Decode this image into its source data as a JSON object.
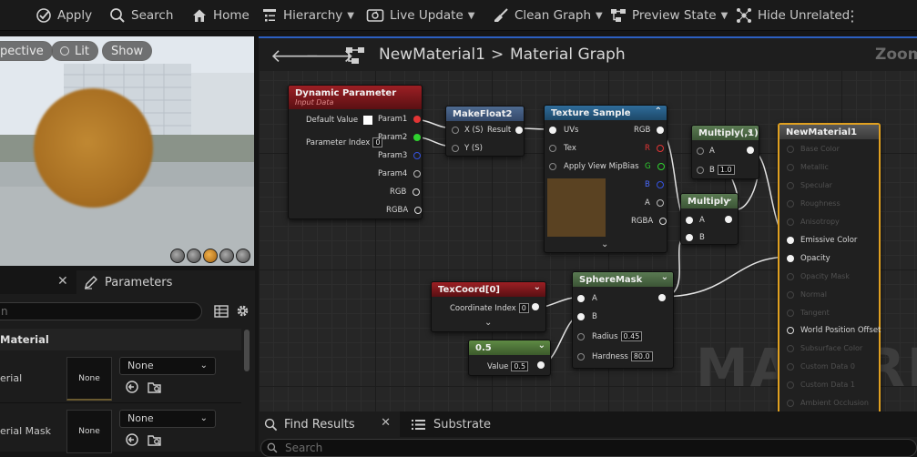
{
  "toolbar": {
    "apply": "Apply",
    "search": "Search",
    "home": "Home",
    "hierarchy": "Hierarchy",
    "live_update": "Live Update",
    "clean_graph": "Clean Graph",
    "preview_state": "Preview State",
    "hide_unrelated": "Hide Unrelated"
  },
  "viewport": {
    "perspective": "pective",
    "lit": "Lit",
    "show": "Show"
  },
  "parameters_panel": {
    "tab_label": "Parameters",
    "search_placeholder": "n",
    "group_label": "Material",
    "rows": [
      {
        "label": "erial",
        "thumb": "None",
        "dropdown": "None"
      },
      {
        "label": "erial Mask",
        "thumb": "None",
        "dropdown": "None"
      }
    ]
  },
  "graph": {
    "material_name": "NewMaterial1",
    "breadcrumb_sep": ">",
    "graph_name": "Material Graph",
    "zoom_label": "Zoom",
    "watermark": "MATERIAL",
    "nodes": {
      "dynamic_param": {
        "title": "Dynamic Parameter",
        "subtitle": "Input Data",
        "default_value_label": "Default Value",
        "param_index_label": "Parameter Index",
        "param_index_value": "0",
        "outputs": [
          "Param1",
          "Param2",
          "Param3",
          "Param4",
          "RGB",
          "RGBA"
        ]
      },
      "makefloat2": {
        "title": "MakeFloat2",
        "in_x": "X (S)",
        "in_y": "Y (S)",
        "out": "Result"
      },
      "texture_sample": {
        "title": "Texture Sample",
        "inputs": [
          "UVs",
          "Tex",
          "Apply View MipBias"
        ],
        "outputs": [
          "RGB",
          "R",
          "G",
          "B",
          "A",
          "RGBA"
        ]
      },
      "multiply1": {
        "title": "Multiply(,1)",
        "in_a": "A",
        "in_b": "B",
        "b_value": "1.0"
      },
      "multiply2": {
        "title": "Multiply",
        "in_a": "A",
        "in_b": "B"
      },
      "texcoord": {
        "title": "TexCoord[0]",
        "coord_label": "Coordinate Index",
        "coord_value": "0"
      },
      "const": {
        "title": "0.5",
        "value_label": "Value",
        "value": "0.5"
      },
      "spheremask": {
        "title": "SphereMask",
        "in_a": "A",
        "in_b": "B",
        "radius_label": "Radius",
        "radius_value": "0.45",
        "hardness_label": "Hardness",
        "hardness_value": "80.0"
      },
      "result": {
        "title": "NewMaterial1",
        "pins": [
          "Base Color",
          "Metallic",
          "Specular",
          "Roughness",
          "Anisotropy",
          "Emissive Color",
          "Opacity",
          "Opacity Mask",
          "Normal",
          "Tangent",
          "World Position Offset",
          "Subsurface Color",
          "Custom Data 0",
          "Custom Data 1",
          "Ambient Occlusion"
        ]
      }
    }
  },
  "bottom_panel": {
    "find_results": "Find Results",
    "substrate": "Substrate",
    "search_placeholder": "Search"
  }
}
